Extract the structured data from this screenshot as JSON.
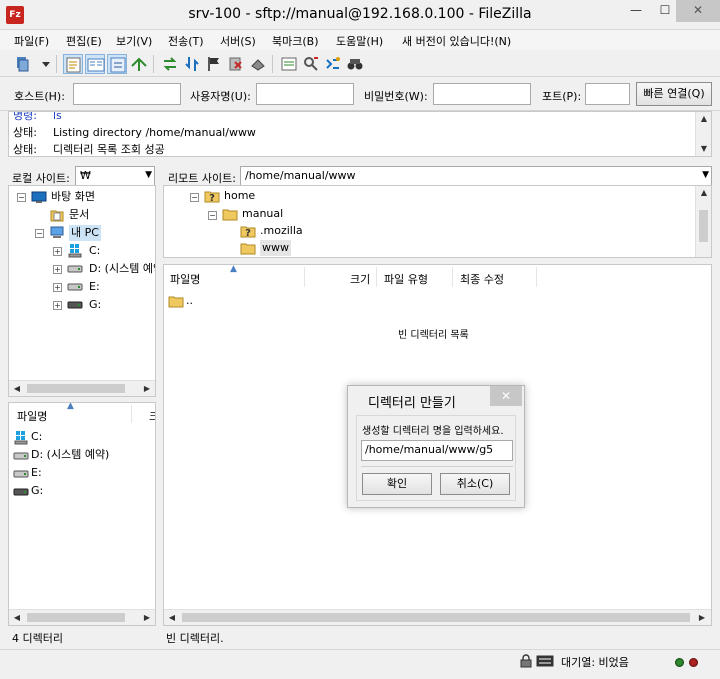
{
  "window": {
    "app_icon_letter": "Fz",
    "title": "srv-100 - sftp://manual@192.168.0.100 - FileZilla",
    "minimize": "—",
    "maximize": "☐",
    "close": "✕"
  },
  "menu": [
    "파일(F)",
    "편집(E)",
    "보기(V)",
    "전송(T)",
    "서버(S)",
    "북마크(B)",
    "도움말(H)",
    "새 버전이 있습니다!(N)"
  ],
  "quickconnect": {
    "host_label": "호스트(H):",
    "user_label": "사용자명(U):",
    "password_label": "비밀번호(W):",
    "port_label": "포트(P):",
    "connect_button": "빠른 연결(Q)",
    "host_value": "",
    "user_value": "",
    "password_value": "",
    "port_value": ""
  },
  "log": [
    {
      "tag": "명령:",
      "text": "ls",
      "kind": "cmd"
    },
    {
      "tag": "상태:",
      "text": "Listing directory /home/manual/www",
      "kind": "status"
    },
    {
      "tag": "상태:",
      "text": "디렉터리 목록 조회 성공",
      "kind": "status"
    }
  ],
  "local": {
    "site_label": "로컬 사이트:",
    "site_path": "₩",
    "tree": [
      {
        "label": "바탕 화면",
        "icon": "desktop-icon",
        "level": 0,
        "expander": "−"
      },
      {
        "label": "문서",
        "icon": "documents-icon",
        "level": 1,
        "expander": ""
      },
      {
        "label": "내 PC",
        "icon": "computer-icon",
        "level": 1,
        "expander": "−"
      },
      {
        "label": "C:",
        "icon": "windows-drive-icon",
        "level": 2,
        "expander": "+"
      },
      {
        "label": "D: (시스템 예약)",
        "icon": "drive-icon",
        "level": 2,
        "expander": "+"
      },
      {
        "label": "E:",
        "icon": "drive-icon",
        "level": 2,
        "expander": "+"
      },
      {
        "label": "G:",
        "icon": "drive-icon",
        "level": 2,
        "expander": "+"
      }
    ],
    "columns": [
      "파일명",
      "크"
    ],
    "files": [
      {
        "name": "C:",
        "icon": "windows-drive-icon"
      },
      {
        "name": "D: (시스템 예약)",
        "icon": "drive-icon"
      },
      {
        "name": "E:",
        "icon": "drive-icon"
      },
      {
        "name": "G:",
        "icon": "drive-icon"
      }
    ],
    "status": "4 디렉터리"
  },
  "remote": {
    "site_label": "리모트 사이트:",
    "site_path": "/home/manual/www",
    "tree": [
      {
        "label": "home",
        "icon": "unknown-folder-icon",
        "level": 0,
        "expander": "−"
      },
      {
        "label": "manual",
        "icon": "folder-icon",
        "level": 1,
        "expander": "−"
      },
      {
        "label": ".mozilla",
        "icon": "unknown-folder-icon",
        "level": 2,
        "expander": ""
      },
      {
        "label": "www",
        "icon": "folder-icon",
        "level": 2,
        "expander": ""
      }
    ],
    "columns": [
      "파일명",
      "크기",
      "파일 유형",
      "최종 수정"
    ],
    "parent_entry": "..",
    "empty_message": "빈 디렉터리 목록",
    "status": "빈 디렉터리."
  },
  "dialog": {
    "title": "디렉터리 만들기",
    "close": "✕",
    "prompt": "생성할 디렉터리 명을 입력하세요.",
    "value": "/home/manual/www/g5",
    "ok_button": "확인",
    "cancel_button": "취소(C)"
  },
  "queue_status": "대기열: 비었음",
  "colors": {
    "accent_red": "#c8251e",
    "led_green": "#2f8a2f",
    "led_red": "#b22222",
    "selection_bg": "#cde4f7"
  }
}
